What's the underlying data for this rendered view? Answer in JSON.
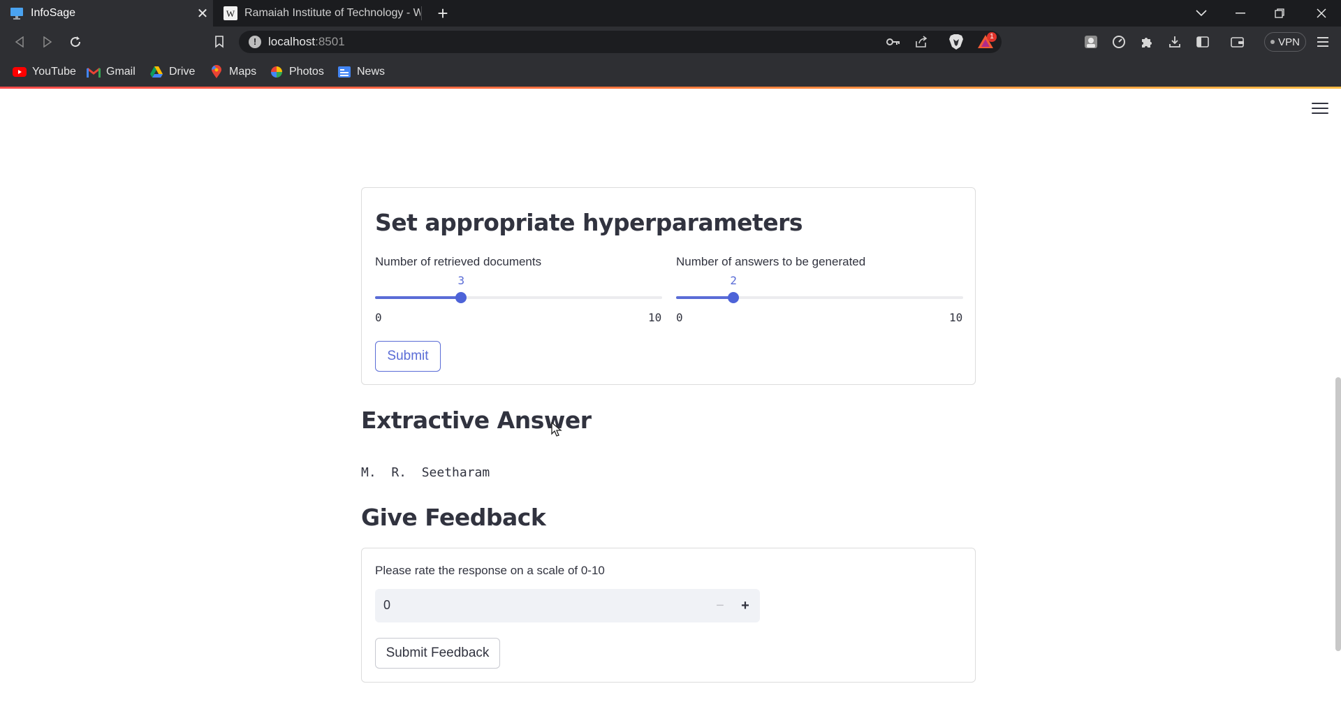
{
  "browser": {
    "tabs": [
      {
        "title": "InfoSage",
        "active": true
      },
      {
        "title": "Ramaiah Institute of Technology - Wik",
        "active": false
      }
    ],
    "address": {
      "host": "localhost",
      "port": ":8501"
    },
    "vpn_label": "VPN",
    "rewards_badge": "1",
    "bookmarks": [
      {
        "label": "YouTube",
        "icon": "youtube-icon"
      },
      {
        "label": "Gmail",
        "icon": "gmail-icon"
      },
      {
        "label": "Drive",
        "icon": "drive-icon"
      },
      {
        "label": "Maps",
        "icon": "maps-icon"
      },
      {
        "label": "Photos",
        "icon": "photos-icon"
      },
      {
        "label": "News",
        "icon": "news-icon"
      }
    ],
    "accent_colors": {
      "progress_start": "#ff4b4b",
      "progress_end": "#ffbd45"
    }
  },
  "hyperparams": {
    "title": "Set appropriate hyperparameters",
    "sliders": [
      {
        "label": "Number of retrieved documents",
        "value": 3,
        "min": 0,
        "max": 10,
        "min_label": "0",
        "max_label": "10"
      },
      {
        "label": "Number of answers to be generated",
        "value": 2,
        "min": 0,
        "max": 10,
        "min_label": "0",
        "max_label": "10"
      }
    ],
    "submit_label": "Submit"
  },
  "answer": {
    "title": "Extractive Answer",
    "text": "M.  R.  Seetharam"
  },
  "feedback": {
    "title": "Give Feedback",
    "prompt": "Please rate the response on a scale of 0-10",
    "value": "0",
    "minus": "−",
    "plus": "+",
    "submit_label": "Submit Feedback"
  },
  "theme": {
    "primary": "#5a6cd6",
    "text": "#31333f"
  }
}
